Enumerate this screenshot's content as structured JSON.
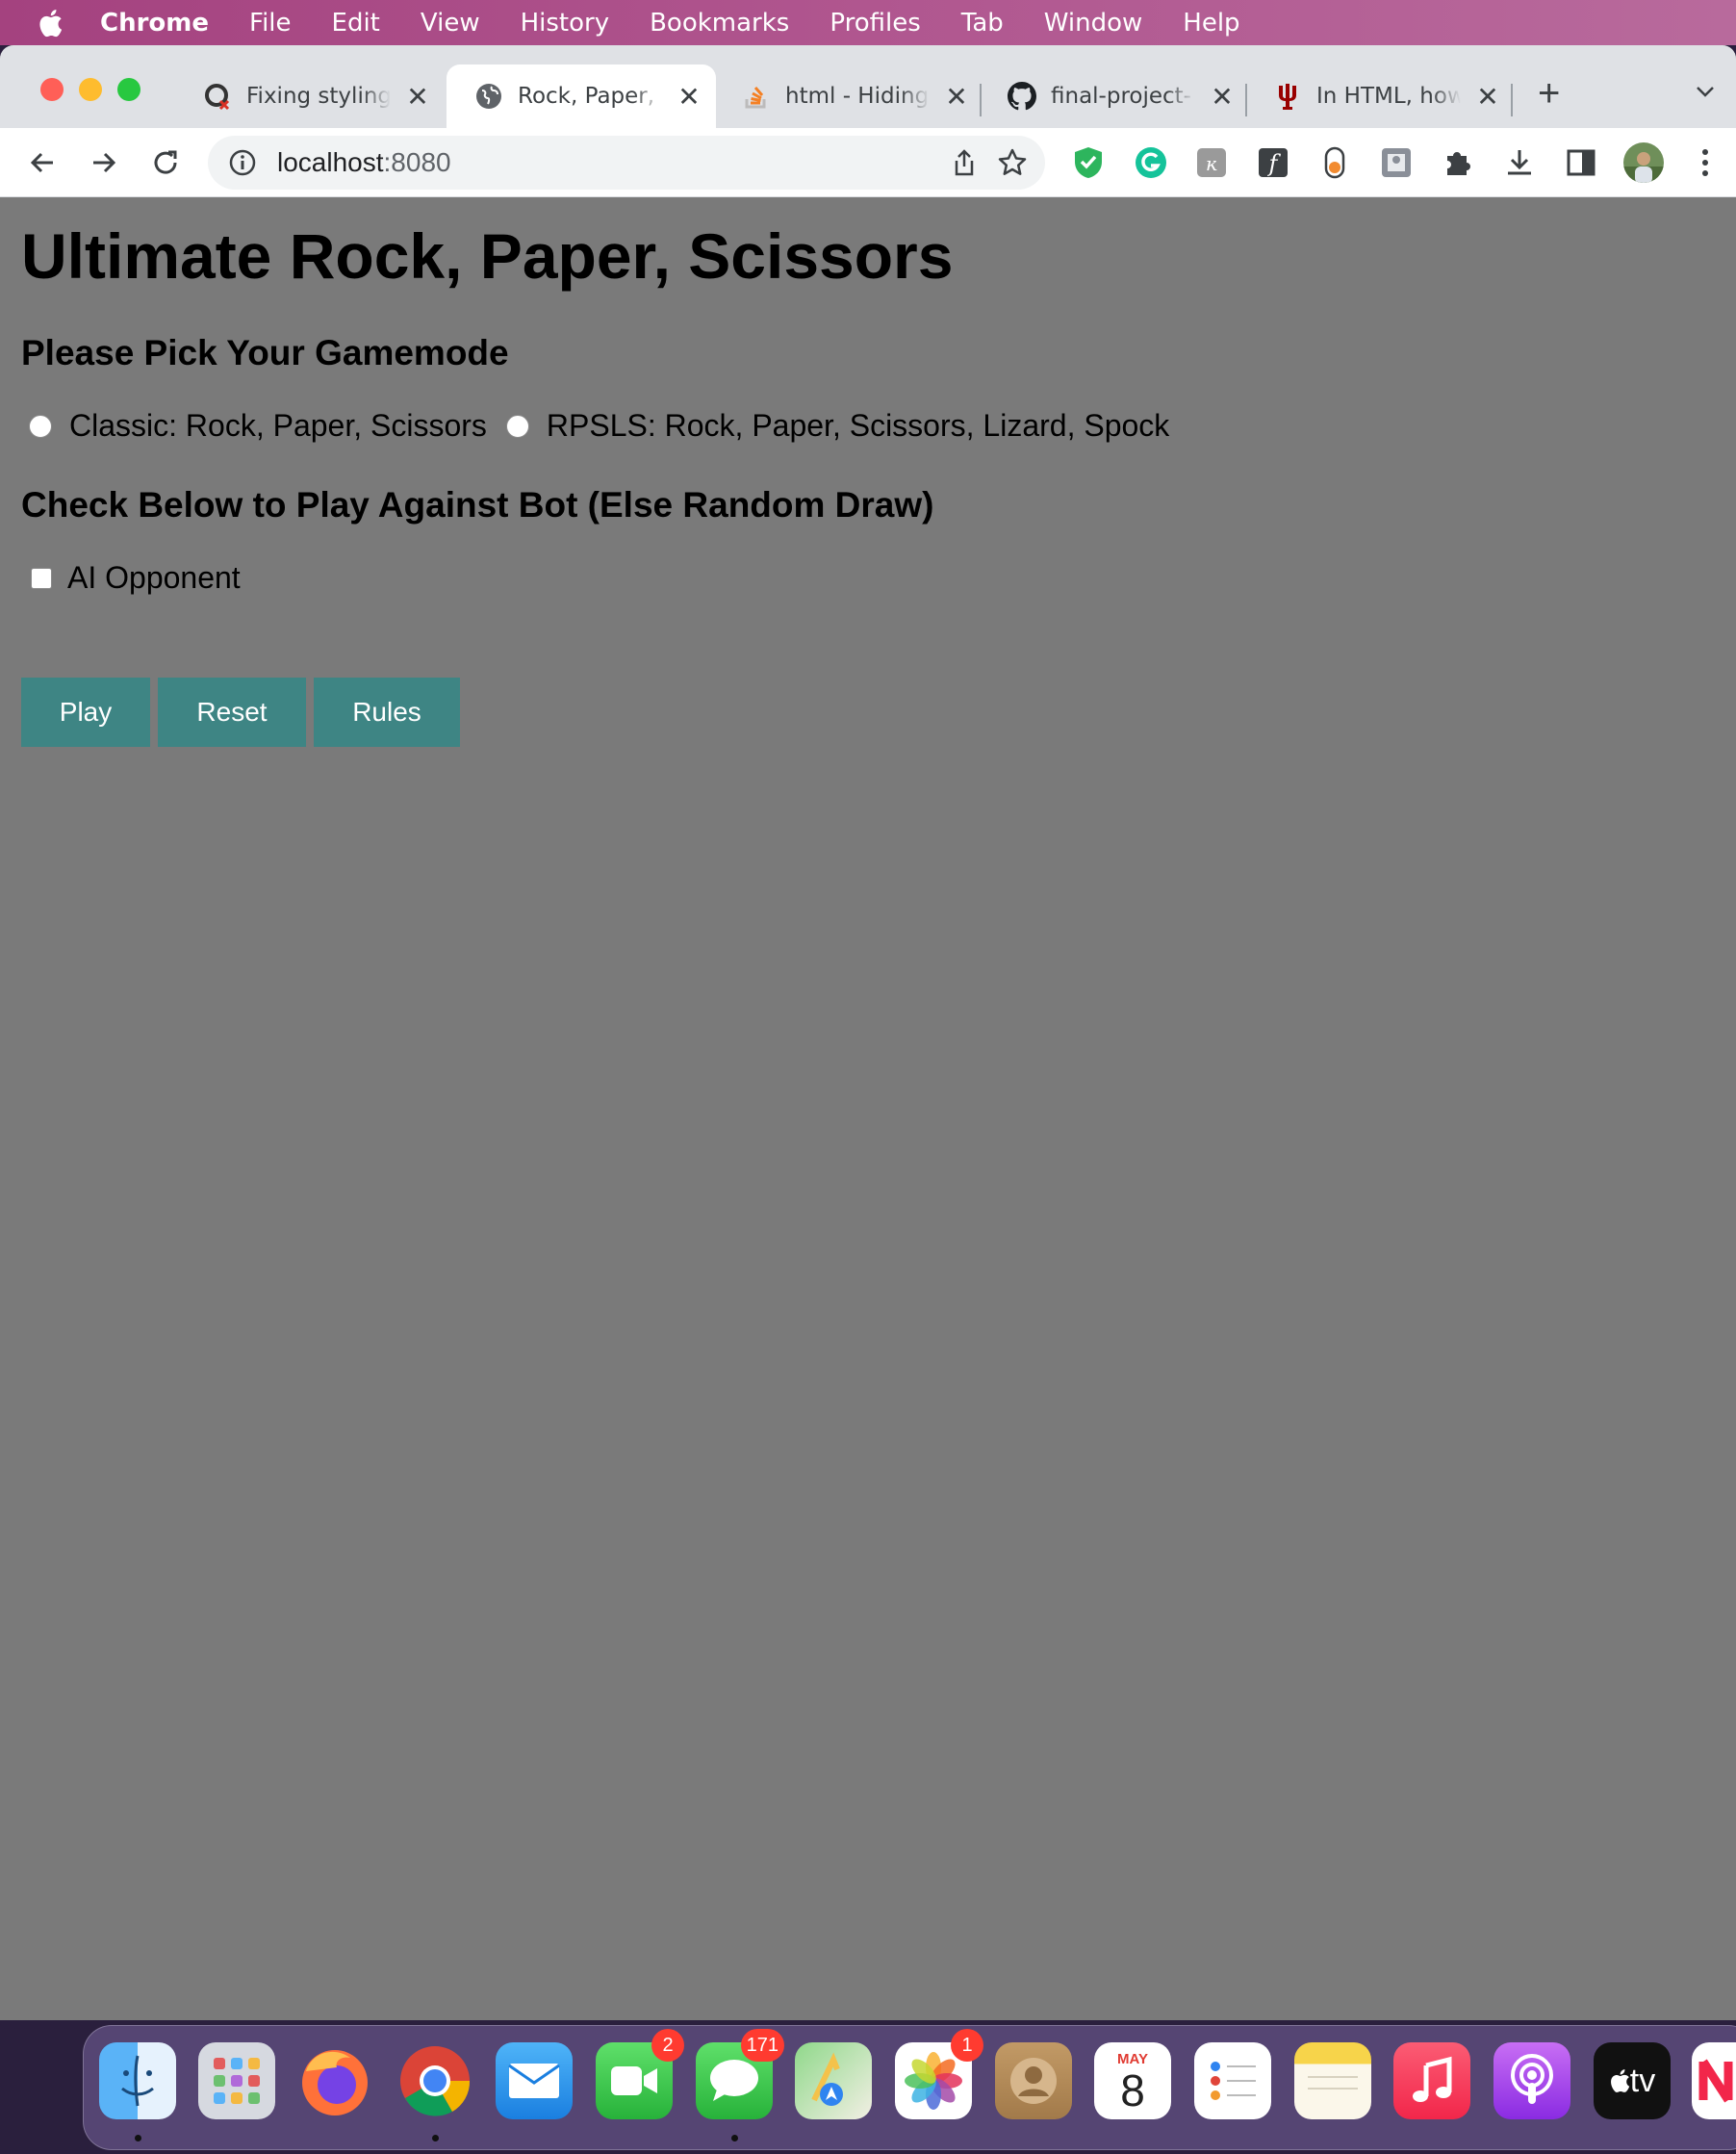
{
  "menubar": {
    "app_name": "Chrome",
    "items": [
      "File",
      "Edit",
      "View",
      "History",
      "Bookmarks",
      "Profiles",
      "Tab",
      "Window",
      "Help"
    ]
  },
  "tabs": [
    {
      "title": "Fixing styling",
      "icon": "broken-sync-icon",
      "active": false
    },
    {
      "title": "Rock, Paper,",
      "icon": "globe-icon",
      "active": true
    },
    {
      "title": "html - Hiding",
      "icon": "stackoverflow-icon",
      "active": false
    },
    {
      "title": "final-project-",
      "icon": "github-icon",
      "active": false
    },
    {
      "title": "In HTML, how",
      "icon": "iu-trident-icon",
      "active": false
    }
  ],
  "address_bar": {
    "host": "localhost",
    "port": ":8080"
  },
  "page": {
    "title": "Ultimate Rock, Paper, Scissors",
    "gamemode_heading": "Please Pick Your Gamemode",
    "gamemode_options": [
      {
        "label": "Classic: Rock, Paper, Scissors",
        "checked": false
      },
      {
        "label": "RPSLS: Rock, Paper, Scissors, Lizard, Spock",
        "checked": false
      }
    ],
    "bot_heading": "Check Below to Play Against Bot (Else Random Draw)",
    "ai_checkbox": {
      "label": "AI Opponent",
      "checked": false
    },
    "buttons": {
      "play": "Play",
      "reset": "Reset",
      "rules": "Rules"
    },
    "colors": {
      "background": "#7a7a7a",
      "button": "#3e8584"
    }
  },
  "dock": {
    "apps": [
      {
        "name": "finder-icon"
      },
      {
        "name": "launchpad-icon"
      },
      {
        "name": "firefox-icon"
      },
      {
        "name": "chrome-icon"
      },
      {
        "name": "mail-icon"
      },
      {
        "name": "facetime-icon",
        "badge": "2"
      },
      {
        "name": "messages-icon",
        "badge": "171"
      },
      {
        "name": "maps-icon"
      },
      {
        "name": "photos-icon",
        "badge": "1"
      },
      {
        "name": "contacts-icon"
      },
      {
        "name": "calendar-icon",
        "month": "MAY",
        "day": "8"
      },
      {
        "name": "reminders-icon"
      },
      {
        "name": "notes-icon"
      },
      {
        "name": "music-icon"
      },
      {
        "name": "podcasts-icon"
      },
      {
        "name": "tv-icon",
        "label": "tv"
      },
      {
        "name": "news-icon"
      }
    ]
  }
}
